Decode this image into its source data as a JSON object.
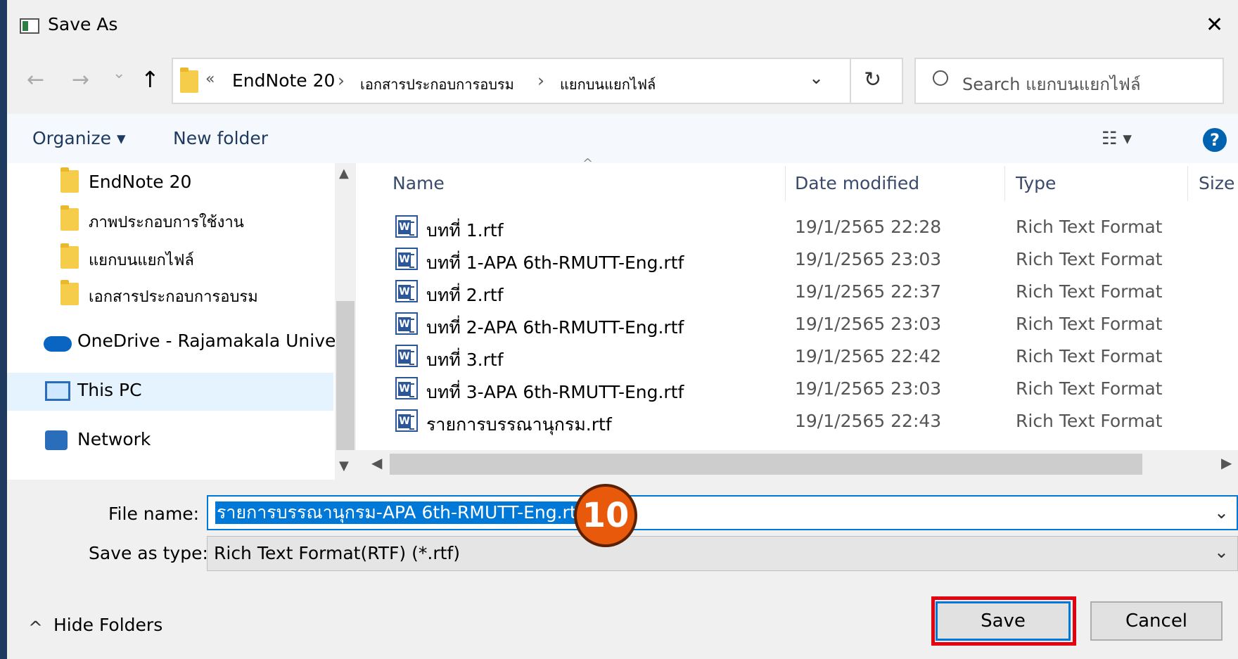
{
  "window": {
    "title": "Save As",
    "close_glyph": "✕"
  },
  "nav": {
    "back_glyph": "←",
    "forward_glyph": "→",
    "dropdown_glyph": "⌄",
    "up_glyph": "↑",
    "breadcrumb_overflow": "«",
    "breadcrumb": [
      "EndNote 20",
      "เอกสารประกอบการอบรม",
      "แยกบนแยกไฟล์"
    ],
    "separator": "›",
    "refresh_glyph": "↻",
    "search_placeholder": "Search แยกบนแยกไฟล์"
  },
  "toolbar": {
    "organize": "Organize ▾",
    "new_folder": "New folder",
    "view_glyph": "☷ ▾",
    "help": "?"
  },
  "sidebar": {
    "folders": [
      "EndNote 20",
      "ภาพประกอบการใช้งาน",
      "แยกบนแยกไฟล์",
      "เอกสารประกอบการอบรม"
    ],
    "onedrive": "OneDrive - Rajamakala Universi",
    "this_pc": "This PC",
    "network": "Network"
  },
  "columns": {
    "name": "Name",
    "date": "Date modified",
    "type": "Type",
    "size": "Size"
  },
  "files": [
    {
      "name": "บทที่ 1.rtf",
      "date": "19/1/2565 22:28",
      "type": "Rich Text Format"
    },
    {
      "name": "บทที่ 1-APA 6th-RMUTT-Eng.rtf",
      "date": "19/1/2565 23:03",
      "type": "Rich Text Format"
    },
    {
      "name": "บทที่ 2.rtf",
      "date": "19/1/2565 22:37",
      "type": "Rich Text Format"
    },
    {
      "name": "บทที่ 2-APA 6th-RMUTT-Eng.rtf",
      "date": "19/1/2565 23:03",
      "type": "Rich Text Format"
    },
    {
      "name": "บทที่ 3.rtf",
      "date": "19/1/2565 22:42",
      "type": "Rich Text Format"
    },
    {
      "name": "บทที่ 3-APA 6th-RMUTT-Eng.rtf",
      "date": "19/1/2565 23:03",
      "type": "Rich Text Format"
    },
    {
      "name": "รายการบรรณานุกรม.rtf",
      "date": "19/1/2565 22:43",
      "type": "Rich Text Format"
    }
  ],
  "form": {
    "file_name_label": "File name:",
    "file_name_value": "รายการบรรณานุกรม-APA 6th-RMUTT-Eng.rtf",
    "save_type_label": "Save as type:",
    "save_type_value": "Rich Text Format(RTF) (*.rtf)",
    "dropdown_glyph": "⌄"
  },
  "annotation": {
    "step": "10"
  },
  "footer": {
    "hide_folders": "Hide Folders",
    "hide_glyph": "^",
    "save": "Save",
    "cancel": "Cancel"
  },
  "colors": {
    "accent": "#0078d7",
    "highlight": "#e3000f",
    "badge": "#e8590c"
  }
}
